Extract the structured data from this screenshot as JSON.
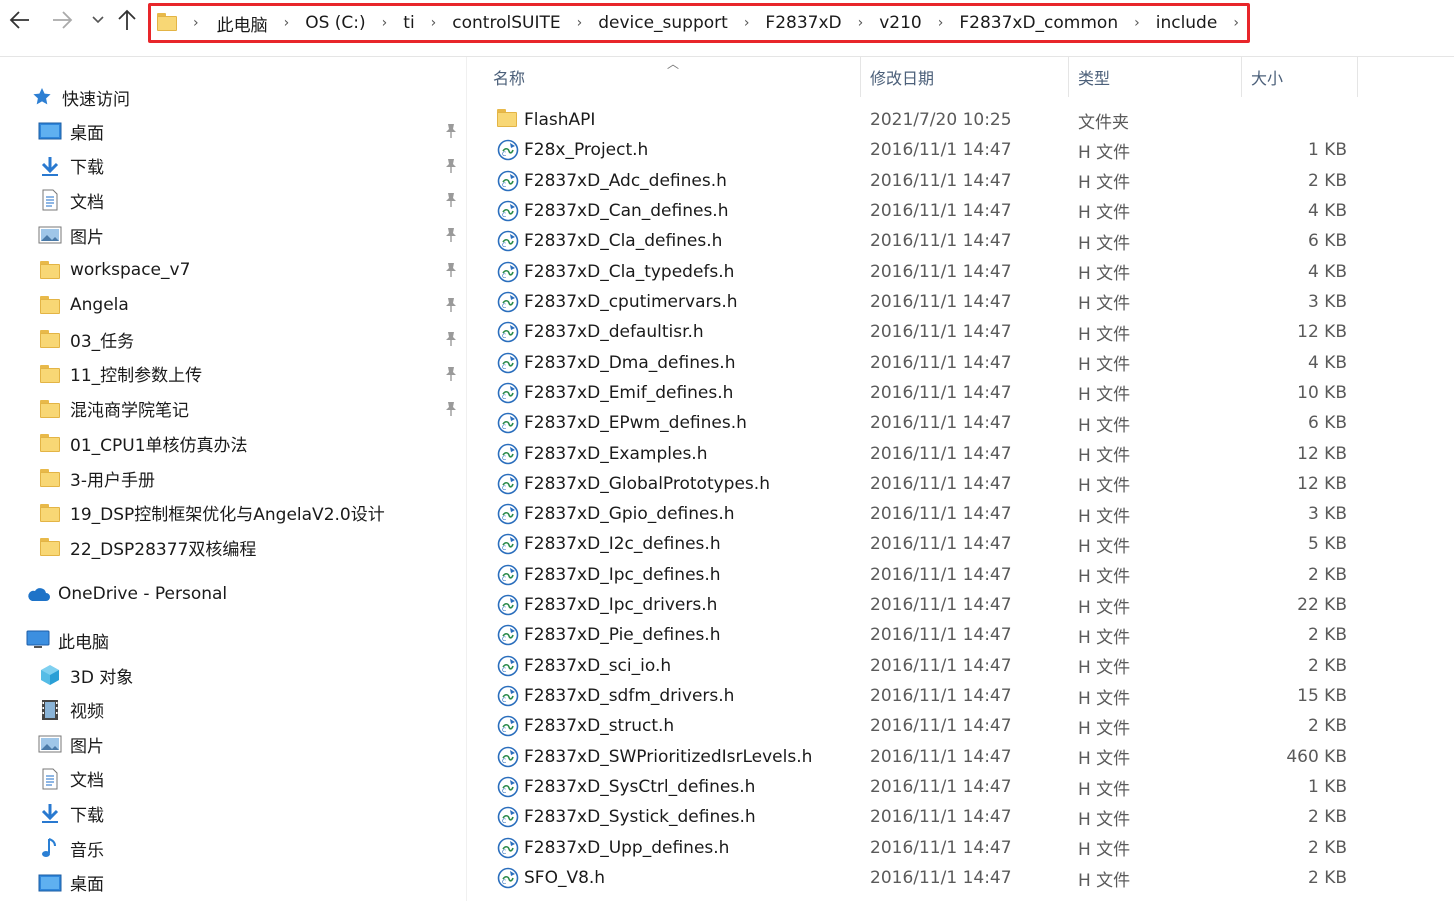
{
  "nav": {
    "back_icon": "arrow-left-icon",
    "forward_icon": "arrow-right-icon",
    "recent_icon": "chevron-down-icon",
    "up_icon": "arrow-up-icon"
  },
  "breadcrumb": [
    "此电脑",
    "OS (C:)",
    "ti",
    "controlSUITE",
    "device_support",
    "F2837xD",
    "v210",
    "F2837xD_common",
    "include"
  ],
  "columns": {
    "name": "名称",
    "date": "修改日期",
    "type": "类型",
    "size": "大小"
  },
  "sidebar": {
    "quick_access": "快速访问",
    "quick_items": [
      {
        "label": "桌面",
        "icon": "desktop-icon",
        "pinned": true
      },
      {
        "label": "下载",
        "icon": "download-icon",
        "pinned": true
      },
      {
        "label": "文档",
        "icon": "document-icon",
        "pinned": true
      },
      {
        "label": "图片",
        "icon": "pictures-icon",
        "pinned": true
      },
      {
        "label": "workspace_v7",
        "icon": "folder-icon",
        "pinned": true
      },
      {
        "label": "Angela",
        "icon": "folder-icon",
        "pinned": true
      },
      {
        "label": "03_任务",
        "icon": "folder-icon",
        "pinned": true
      },
      {
        "label": "11_控制参数上传",
        "icon": "folder-icon",
        "pinned": true
      },
      {
        "label": "混沌商学院笔记",
        "icon": "folder-icon",
        "pinned": true
      },
      {
        "label": "01_CPU1单核仿真办法",
        "icon": "folder-icon",
        "pinned": false
      },
      {
        "label": "3-用户手册",
        "icon": "folder-icon",
        "pinned": false
      },
      {
        "label": "19_DSP控制框架优化与AngelaV2.0设计",
        "icon": "folder-icon",
        "pinned": false
      },
      {
        "label": "22_DSP28377双核编程",
        "icon": "folder-icon",
        "pinned": false
      }
    ],
    "onedrive": "OneDrive - Personal",
    "this_pc": "此电脑",
    "pc_items": [
      {
        "label": "3D 对象",
        "icon": "3d-objects-icon"
      },
      {
        "label": "视频",
        "icon": "video-icon"
      },
      {
        "label": "图片",
        "icon": "pictures-icon"
      },
      {
        "label": "文档",
        "icon": "document-icon"
      },
      {
        "label": "下载",
        "icon": "download-icon"
      },
      {
        "label": "音乐",
        "icon": "music-icon"
      },
      {
        "label": "桌面",
        "icon": "desktop-icon"
      }
    ]
  },
  "files": [
    {
      "name": "FlashAPI",
      "date": "2021/7/20 10:25",
      "type": "文件夹",
      "size": "",
      "icon": "folder-icon"
    },
    {
      "name": "F28x_Project.h",
      "date": "2016/11/1 14:47",
      "type": "H 文件",
      "size": "1 KB",
      "icon": "h-file-icon"
    },
    {
      "name": "F2837xD_Adc_defines.h",
      "date": "2016/11/1 14:47",
      "type": "H 文件",
      "size": "2 KB",
      "icon": "h-file-icon"
    },
    {
      "name": "F2837xD_Can_defines.h",
      "date": "2016/11/1 14:47",
      "type": "H 文件",
      "size": "4 KB",
      "icon": "h-file-icon"
    },
    {
      "name": "F2837xD_Cla_defines.h",
      "date": "2016/11/1 14:47",
      "type": "H 文件",
      "size": "6 KB",
      "icon": "h-file-icon"
    },
    {
      "name": "F2837xD_Cla_typedefs.h",
      "date": "2016/11/1 14:47",
      "type": "H 文件",
      "size": "4 KB",
      "icon": "h-file-icon"
    },
    {
      "name": "F2837xD_cputimervars.h",
      "date": "2016/11/1 14:47",
      "type": "H 文件",
      "size": "3 KB",
      "icon": "h-file-icon"
    },
    {
      "name": "F2837xD_defaultisr.h",
      "date": "2016/11/1 14:47",
      "type": "H 文件",
      "size": "12 KB",
      "icon": "h-file-icon"
    },
    {
      "name": "F2837xD_Dma_defines.h",
      "date": "2016/11/1 14:47",
      "type": "H 文件",
      "size": "4 KB",
      "icon": "h-file-icon"
    },
    {
      "name": "F2837xD_Emif_defines.h",
      "date": "2016/11/1 14:47",
      "type": "H 文件",
      "size": "10 KB",
      "icon": "h-file-icon"
    },
    {
      "name": "F2837xD_EPwm_defines.h",
      "date": "2016/11/1 14:47",
      "type": "H 文件",
      "size": "6 KB",
      "icon": "h-file-icon"
    },
    {
      "name": "F2837xD_Examples.h",
      "date": "2016/11/1 14:47",
      "type": "H 文件",
      "size": "12 KB",
      "icon": "h-file-icon"
    },
    {
      "name": "F2837xD_GlobalPrototypes.h",
      "date": "2016/11/1 14:47",
      "type": "H 文件",
      "size": "12 KB",
      "icon": "h-file-icon"
    },
    {
      "name": "F2837xD_Gpio_defines.h",
      "date": "2016/11/1 14:47",
      "type": "H 文件",
      "size": "3 KB",
      "icon": "h-file-icon"
    },
    {
      "name": "F2837xD_I2c_defines.h",
      "date": "2016/11/1 14:47",
      "type": "H 文件",
      "size": "5 KB",
      "icon": "h-file-icon"
    },
    {
      "name": "F2837xD_Ipc_defines.h",
      "date": "2016/11/1 14:47",
      "type": "H 文件",
      "size": "2 KB",
      "icon": "h-file-icon"
    },
    {
      "name": "F2837xD_Ipc_drivers.h",
      "date": "2016/11/1 14:47",
      "type": "H 文件",
      "size": "22 KB",
      "icon": "h-file-icon"
    },
    {
      "name": "F2837xD_Pie_defines.h",
      "date": "2016/11/1 14:47",
      "type": "H 文件",
      "size": "2 KB",
      "icon": "h-file-icon"
    },
    {
      "name": "F2837xD_sci_io.h",
      "date": "2016/11/1 14:47",
      "type": "H 文件",
      "size": "2 KB",
      "icon": "h-file-icon"
    },
    {
      "name": "F2837xD_sdfm_drivers.h",
      "date": "2016/11/1 14:47",
      "type": "H 文件",
      "size": "15 KB",
      "icon": "h-file-icon"
    },
    {
      "name": "F2837xD_struct.h",
      "date": "2016/11/1 14:47",
      "type": "H 文件",
      "size": "2 KB",
      "icon": "h-file-icon"
    },
    {
      "name": "F2837xD_SWPrioritizedIsrLevels.h",
      "date": "2016/11/1 14:47",
      "type": "H 文件",
      "size": "460 KB",
      "icon": "h-file-icon"
    },
    {
      "name": "F2837xD_SysCtrl_defines.h",
      "date": "2016/11/1 14:47",
      "type": "H 文件",
      "size": "1 KB",
      "icon": "h-file-icon"
    },
    {
      "name": "F2837xD_Systick_defines.h",
      "date": "2016/11/1 14:47",
      "type": "H 文件",
      "size": "2 KB",
      "icon": "h-file-icon"
    },
    {
      "name": "F2837xD_Upp_defines.h",
      "date": "2016/11/1 14:47",
      "type": "H 文件",
      "size": "2 KB",
      "icon": "h-file-icon"
    },
    {
      "name": "SFO_V8.h",
      "date": "2016/11/1 14:47",
      "type": "H 文件",
      "size": "2 KB",
      "icon": "h-file-icon"
    }
  ],
  "colors": {
    "highlight_border": "#e8262a",
    "header_text": "#4c607a",
    "folder": "#f8d775",
    "accent_blue": "#1e73c8"
  }
}
